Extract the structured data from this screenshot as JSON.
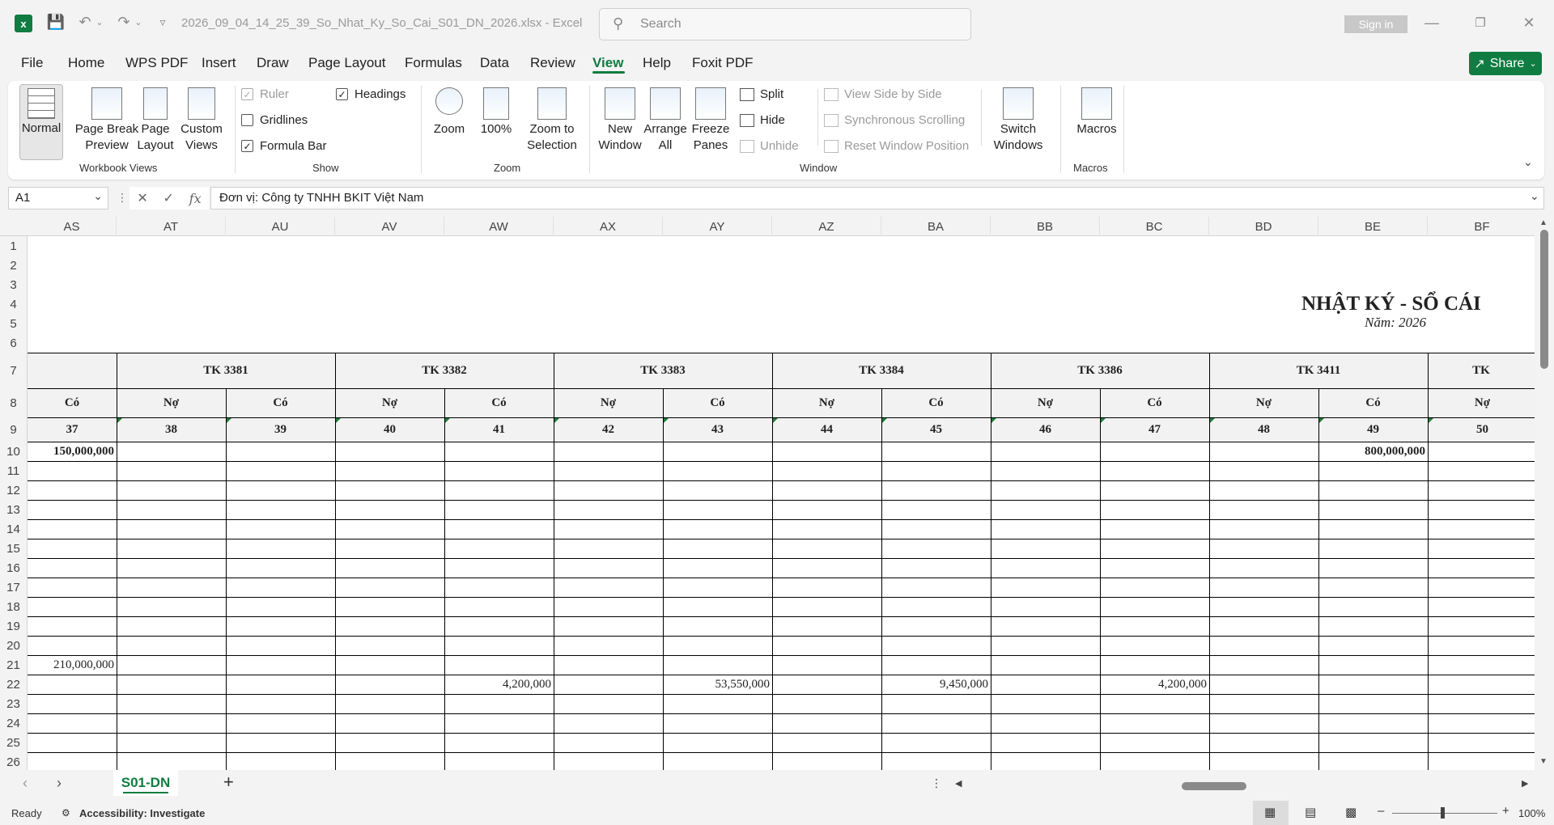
{
  "window": {
    "filename": "2026_09_04_14_25_39_So_Nhat_Ky_So_Cai_S01_DN_2026.xlsx  -  Excel",
    "search_placeholder": "Search",
    "signin": "Sign in",
    "share": "Share"
  },
  "menu": [
    "File",
    "Home",
    "WPS PDF",
    "Insert",
    "Draw",
    "Page Layout",
    "Formulas",
    "Data",
    "Review",
    "View",
    "Help",
    "Foxit PDF"
  ],
  "active_tab": "View",
  "ribbon": {
    "workbook_views": {
      "label": "Workbook Views",
      "normal": "Normal",
      "page_break": "Page Break Preview",
      "page_layout": "Page Layout",
      "custom_views": "Custom Views"
    },
    "show": {
      "label": "Show",
      "ruler": "Ruler",
      "gridlines": "Gridlines",
      "formula_bar": "Formula Bar",
      "headings": "Headings"
    },
    "zoom": {
      "label": "Zoom",
      "zoom": "Zoom",
      "hundred": "100%",
      "zoom_selection": "Zoom to Selection"
    },
    "window": {
      "label": "Window",
      "new_window": "New Window",
      "arrange_all": "Arrange All",
      "freeze_panes": "Freeze Panes",
      "split": "Split",
      "hide": "Hide",
      "unhide": "Unhide",
      "side_by_side": "View Side by Side",
      "sync_scroll": "Synchronous Scrolling",
      "reset_pos": "Reset Window Position",
      "switch_windows": "Switch Windows"
    },
    "macros": {
      "label": "Macros",
      "macros": "Macros"
    }
  },
  "formula_bar": {
    "name_box": "A1",
    "fx": "fx",
    "content": "Đơn vị: Công ty TNHH BKIT Việt Nam"
  },
  "columns": [
    "AS",
    "AT",
    "AU",
    "AV",
    "AW",
    "AX",
    "AY",
    "AZ",
    "BA",
    "BB",
    "BC",
    "BD",
    "BE",
    "BF"
  ],
  "rows": [
    "1",
    "2",
    "3",
    "4",
    "5",
    "6",
    "7",
    "8",
    "9",
    "10",
    "11",
    "12",
    "13",
    "14",
    "15",
    "16",
    "17",
    "18",
    "19",
    "20",
    "21",
    "22",
    "23",
    "24",
    "25",
    "26"
  ],
  "sheet": {
    "title": "NHẬT KÝ - SỔ CÁI",
    "subtitle": "Năm: 2026",
    "accounts": [
      "TK 3381",
      "TK 3382",
      "TK 3383",
      "TK 3384",
      "TK 3386",
      "TK 3411",
      "TK"
    ],
    "no": "Nợ",
    "co": "Có",
    "col_numbers": [
      "37",
      "38",
      "39",
      "40",
      "41",
      "42",
      "43",
      "44",
      "45",
      "46",
      "47",
      "48",
      "49",
      "50"
    ],
    "values": {
      "r10_as": "150,000,000",
      "r10_be": "800,000,000",
      "r21_as": "210,000,000",
      "r22_aw": "4,200,000",
      "r22_ay": "53,550,000",
      "r22_ba": "9,450,000",
      "r22_bc": "4,200,000"
    }
  },
  "sheet_tab": "S01-DN",
  "status": {
    "ready": "Ready",
    "accessibility": "Accessibility: Investigate",
    "zoom": "100%"
  }
}
